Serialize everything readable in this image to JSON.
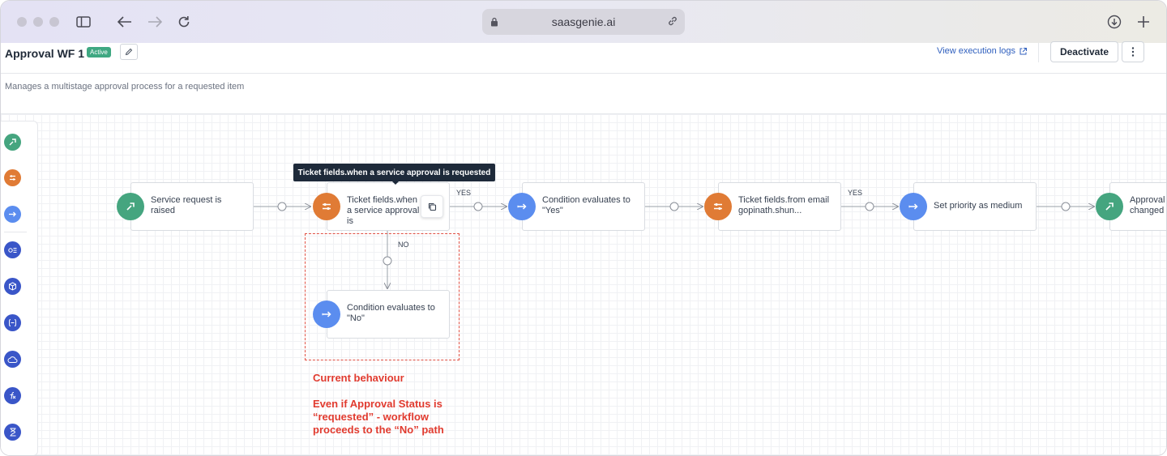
{
  "browser": {
    "url": "saasgenie.ai"
  },
  "header": {
    "title": "Approval WF 1",
    "status_badge": "Active",
    "execution_logs_link": "View execution logs",
    "deactivate_label": "Deactivate"
  },
  "description": "Manages a multistage approval process for a requested item",
  "palette": {
    "items": [
      "trigger-icon",
      "ticket-fields-icon",
      "condition-icon",
      "workflow-icon",
      "package-icon",
      "variable-icon",
      "cloud-icon",
      "function-icon",
      "timer-icon"
    ]
  },
  "tooltip": "Ticket fields.when a service approval is requested",
  "nodes": {
    "service_request": "Service request is raised",
    "ticket_fields_when": "Ticket fields.when a service approval is",
    "condition_yes": "Condition evaluates to \"Yes\"",
    "ticket_fields_from": "Ticket fields.from email gopinath.shun...",
    "set_priority": "Set priority as medium",
    "approval_changed": "Approval changed",
    "condition_no": "Condition evaluates to \"No\""
  },
  "edges": {
    "yes_1": "YES",
    "yes_2": "YES",
    "no": "NO"
  },
  "annotation": {
    "heading": "Current behaviour",
    "line1": "Even if Approval Status is",
    "line2": "“requested” - workflow",
    "line3": "proceeds to the “No” path"
  },
  "colors": {
    "trigger": "#45a57f",
    "ticket_fields": "#e07b35",
    "condition": "#5b8def",
    "annotation": "#e13b2f"
  }
}
